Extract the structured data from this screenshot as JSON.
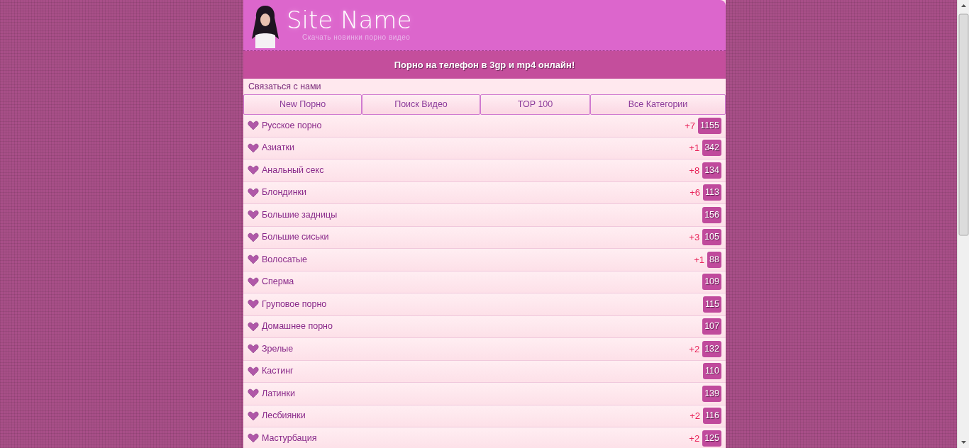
{
  "header": {
    "site_name": "Site Name",
    "tagline": "Скачать новинки порно видео"
  },
  "banner": "Порно на телефон в 3gp и mp4 онлайн!",
  "contact_link": "Связаться с нами",
  "nav": [
    {
      "label": "New Порно"
    },
    {
      "label": "Поиск Видео"
    },
    {
      "label": "TOP 100"
    },
    {
      "label": "Все Категории"
    }
  ],
  "categories": [
    {
      "name": "Русское порно",
      "new": "+7",
      "count": "1155"
    },
    {
      "name": "Азиатки",
      "new": "+1",
      "count": "342"
    },
    {
      "name": "Анальный секс",
      "new": "+8",
      "count": "134"
    },
    {
      "name": "Блондинки",
      "new": "+6",
      "count": "113"
    },
    {
      "name": "Большие задницы",
      "count": "156"
    },
    {
      "name": "Большие сиськи",
      "new": "+3",
      "count": "105"
    },
    {
      "name": "Волосатые",
      "new": "+1",
      "count": "88"
    },
    {
      "name": "Сперма",
      "count": "109"
    },
    {
      "name": "Груповое порно",
      "count": "115"
    },
    {
      "name": "Домашнее порно",
      "count": "107"
    },
    {
      "name": "Зрелые",
      "new": "+2",
      "count": "132"
    },
    {
      "name": "Кастинг",
      "count": "110"
    },
    {
      "name": "Латинки",
      "count": "139"
    },
    {
      "name": "Лесбиянки",
      "new": "+2",
      "count": "116"
    },
    {
      "name": "Мастурбация",
      "new": "+2",
      "count": "125"
    }
  ]
}
